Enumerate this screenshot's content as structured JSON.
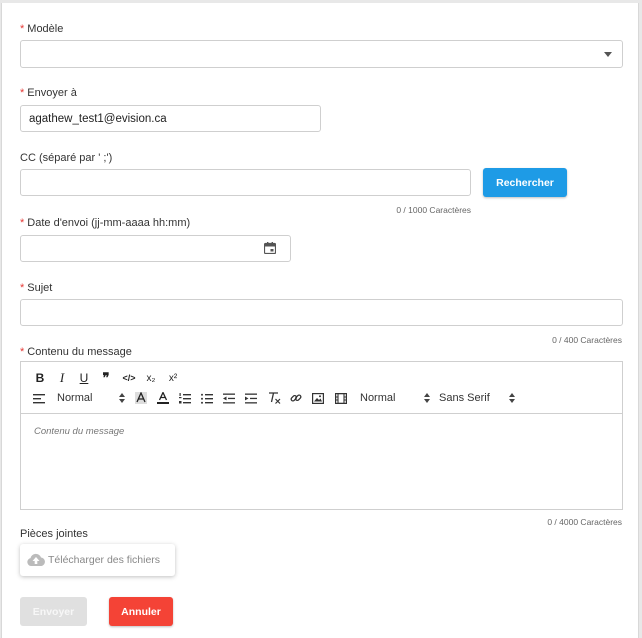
{
  "form": {
    "required_mark": "*",
    "model": {
      "label": "Modèle",
      "value": ""
    },
    "send_to": {
      "label": "Envoyer à",
      "value": "agathew_test1@evision.ca"
    },
    "cc": {
      "label": "CC (séparé par ' ;')",
      "value": "",
      "counter": "0 / 1000 Caractères",
      "search_button": "Rechercher"
    },
    "send_date": {
      "label": "Date d'envoi (jj-mm-aaaa hh:mm)",
      "value": "",
      "icon": "calendar-icon"
    },
    "subject": {
      "label": "Sujet",
      "value": "",
      "counter": "0 / 400 Caractères"
    },
    "content": {
      "label": "Contenu du message",
      "placeholder": "Contenu du message",
      "counter": "0 / 4000 Caractères",
      "toolbar": {
        "bold": "B",
        "italic": "I",
        "underline": "U",
        "quote": "❞",
        "code": "</>",
        "subscript": "x₂",
        "superscript": "x²",
        "header_picker": "Normal",
        "size_picker": "Normal",
        "font_picker": "Sans Serif"
      }
    },
    "attachments": {
      "label": "Pièces jointes",
      "upload_button": "Télécharger des fichiers"
    },
    "send_button": "Envoyer",
    "cancel_button": "Annuler"
  },
  "colors": {
    "primary": "#1e9be6",
    "danger": "#f44336",
    "required": "#e53935",
    "disabled": "#e0e0e0"
  }
}
